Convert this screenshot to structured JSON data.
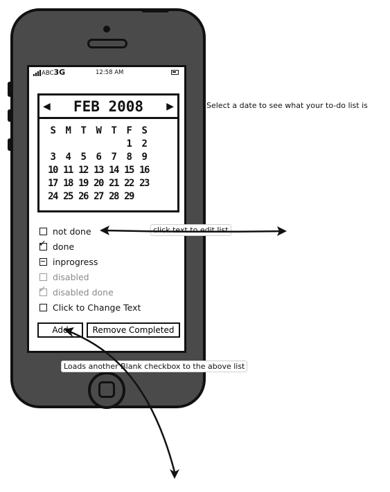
{
  "status_bar": {
    "carrier": "ABC",
    "network": "3G",
    "time": "12:58 AM"
  },
  "calendar": {
    "title": "FEB 2008",
    "prev_icon": "left-triangle-icon",
    "next_icon": "right-triangle-icon",
    "weekdays": [
      "S",
      "M",
      "T",
      "W",
      "T",
      "F",
      "S"
    ],
    "weeks": [
      [
        "",
        "",
        "",
        "",
        "",
        "1",
        "2"
      ],
      [
        "3",
        "4",
        "5",
        "6",
        "7",
        "8",
        "9"
      ],
      [
        "10",
        "11",
        "12",
        "13",
        "14",
        "15",
        "16"
      ],
      [
        "17",
        "18",
        "19",
        "20",
        "21",
        "22",
        "23"
      ],
      [
        "24",
        "25",
        "26",
        "27",
        "28",
        "29",
        ""
      ]
    ]
  },
  "todo": {
    "items": [
      {
        "label": "not done",
        "state": "unchecked",
        "disabled": false
      },
      {
        "label": "done",
        "state": "checked",
        "disabled": false
      },
      {
        "label": "inprogress",
        "state": "indeterminate",
        "disabled": false
      },
      {
        "label": "disabled",
        "state": "unchecked",
        "disabled": true
      },
      {
        "label": "disabled done",
        "state": "checked",
        "disabled": true
      },
      {
        "label": "Click to Change Text",
        "state": "unchecked",
        "disabled": false
      }
    ]
  },
  "buttons": {
    "add": "Add",
    "remove_completed": "Remove Completed"
  },
  "annotations": {
    "select_date": "Select a date to see what your to-do list is",
    "click_text": "click text to edit list",
    "loads_checkbox": "Loads another Blank checkbox to the above list"
  }
}
